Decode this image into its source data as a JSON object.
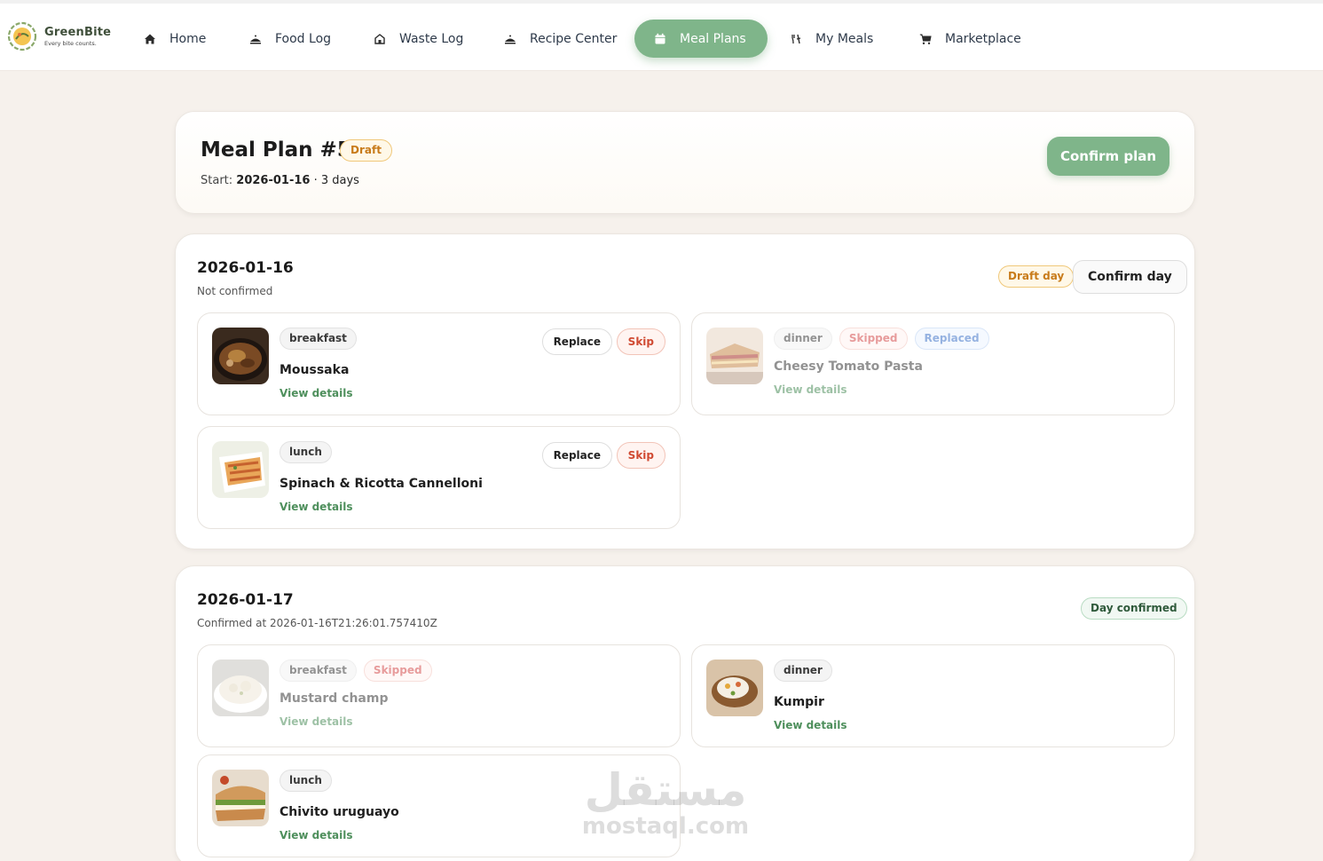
{
  "brand": {
    "name": "GreenBite",
    "tagline": "Every bite counts."
  },
  "nav": {
    "items": [
      {
        "label": "Home",
        "icon": "home-icon"
      },
      {
        "label": "Food Log",
        "icon": "food-icon"
      },
      {
        "label": "Waste Log",
        "icon": "waste-icon"
      },
      {
        "label": "Recipe Center",
        "icon": "recipe-icon"
      },
      {
        "label": "Meal Plans",
        "icon": "calendar-icon",
        "active": true
      },
      {
        "label": "My Meals",
        "icon": "meals-icon"
      },
      {
        "label": "Marketplace",
        "icon": "cart-icon"
      }
    ]
  },
  "plan": {
    "title": "Meal Plan #5",
    "status": "Draft",
    "start_label": "Start:",
    "start_date": "2026-01-16",
    "duration": "· 3 days",
    "confirm_label": "Confirm plan"
  },
  "days": [
    {
      "date": "2026-01-16",
      "status": "Not confirmed",
      "badge": "Draft day",
      "confirm_label": "Confirm day",
      "meals": [
        {
          "type": "breakfast",
          "name": "Moussaka",
          "link": "View details",
          "replace": "Replace",
          "skip": "Skip"
        },
        {
          "type": "dinner",
          "name": "Cheesy Tomato Pasta",
          "link": "View details",
          "tag2": "Skipped",
          "tag3": "Replaced"
        },
        {
          "type": "lunch",
          "name": "Spinach & Ricotta Cannelloni",
          "link": "View details",
          "replace": "Replace",
          "skip": "Skip"
        }
      ]
    },
    {
      "date": "2026-01-17",
      "status": "Confirmed at 2026-01-16T21:26:01.757410Z",
      "badge": "Day confirmed",
      "meals": [
        {
          "type": "breakfast",
          "name": "Mustard champ",
          "link": "View details",
          "tag2": "Skipped"
        },
        {
          "type": "dinner",
          "name": "Kumpir",
          "link": "View details"
        },
        {
          "type": "lunch",
          "name": "Chivito uruguayo",
          "link": "View details"
        }
      ]
    }
  ],
  "watermark": {
    "arabic": "مستقل",
    "latin": "mostaql.com"
  },
  "colors": {
    "accent": "#7fb58a",
    "link": "#4e8f5c",
    "draft": "#c87b1a",
    "skip": "#d54a4a",
    "replaced": "#3f74c9"
  }
}
